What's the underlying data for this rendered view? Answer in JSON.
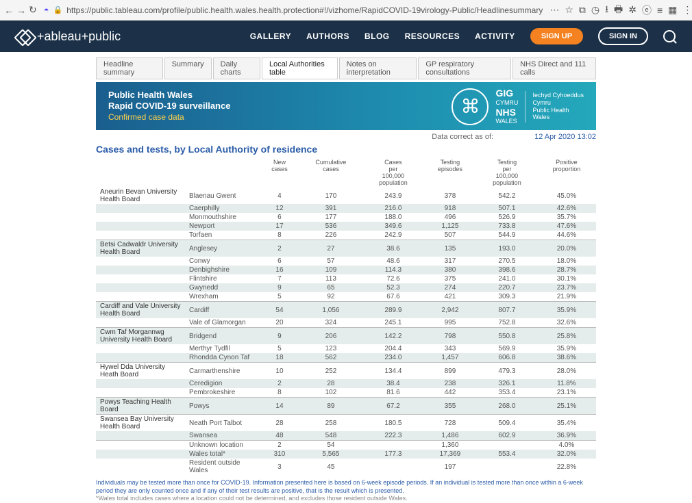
{
  "browser": {
    "url": "https://public.tableau.com/profile/public.health.wales.health.protection#!/vizhome/RapidCOVID-19virology-Public/Headlinesummary"
  },
  "nav": {
    "logo": "+ableau+public",
    "links": [
      "GALLERY",
      "AUTHORS",
      "BLOG",
      "RESOURCES",
      "ACTIVITY"
    ],
    "signup": "SIGN UP",
    "signin": "SIGN IN"
  },
  "tabs": [
    "Headline summary",
    "Summary",
    "Daily charts",
    "Local Authorities table",
    "Notes on interpretation",
    "GP respiratory consultations",
    "NHS Direct and 111 calls"
  ],
  "active_tab": 3,
  "banner": {
    "l1": "Public Health Wales",
    "l2": "Rapid COVID-19 surveillance",
    "l3": "Confirmed case data",
    "gig_l1": "GIG",
    "gig_cymru": "CYMRU",
    "nhs": "NHS",
    "wales": "WALES",
    "r1": "Iechyd Cyhoeddus",
    "r2": "Cymru",
    "r3": "Public Health",
    "r4": "Wales"
  },
  "meta": {
    "label": "Data correct as of:",
    "value": "12 Apr 2020 13:02"
  },
  "title": "Cases and tests, by Local Authority of residence",
  "columns": [
    "New cases",
    "Cumulative cases",
    "Cases per 100,000 population",
    "Testing episodes",
    "Testing per 100,000 population",
    "Positive proportion"
  ],
  "groups": [
    {
      "name": "Aneurin Bevan University Health Board",
      "rows": [
        {
          "la": "Blaenau Gwent",
          "v": [
            "4",
            "170",
            "243.9",
            "378",
            "542.2",
            "45.0%"
          ]
        },
        {
          "la": "Caerphilly",
          "v": [
            "12",
            "391",
            "216.0",
            "918",
            "507.1",
            "42.6%"
          ],
          "sh": 1
        },
        {
          "la": "Monmouthshire",
          "v": [
            "6",
            "177",
            "188.0",
            "496",
            "526.9",
            "35.7%"
          ]
        },
        {
          "la": "Newport",
          "v": [
            "17",
            "536",
            "349.6",
            "1,125",
            "733.8",
            "47.6%"
          ],
          "sh": 1
        },
        {
          "la": "Torfaen",
          "v": [
            "8",
            "226",
            "242.9",
            "507",
            "544.9",
            "44.6%"
          ]
        }
      ]
    },
    {
      "name": "Betsi Cadwaldr University Health Board",
      "rows": [
        {
          "la": "Anglesey",
          "v": [
            "2",
            "27",
            "38.6",
            "135",
            "193.0",
            "20.0%"
          ],
          "sh": 1
        },
        {
          "la": "Conwy",
          "v": [
            "6",
            "57",
            "48.6",
            "317",
            "270.5",
            "18.0%"
          ]
        },
        {
          "la": "Denbighshire",
          "v": [
            "16",
            "109",
            "114.3",
            "380",
            "398.6",
            "28.7%"
          ],
          "sh": 1
        },
        {
          "la": "Flintshire",
          "v": [
            "7",
            "113",
            "72.6",
            "375",
            "241.0",
            "30.1%"
          ]
        },
        {
          "la": "Gwynedd",
          "v": [
            "9",
            "65",
            "52.3",
            "274",
            "220.7",
            "23.7%"
          ],
          "sh": 1
        },
        {
          "la": "Wrexham",
          "v": [
            "5",
            "92",
            "67.6",
            "421",
            "309.3",
            "21.9%"
          ]
        }
      ]
    },
    {
      "name": "Cardiff and Vale University Health Board",
      "rows": [
        {
          "la": "Cardiff",
          "v": [
            "54",
            "1,056",
            "289.9",
            "2,942",
            "807.7",
            "35.9%"
          ],
          "sh": 1
        },
        {
          "la": "Vale of Glamorgan",
          "v": [
            "20",
            "324",
            "245.1",
            "995",
            "752.8",
            "32.6%"
          ]
        }
      ]
    },
    {
      "name": "Cwm Taf Morgannwg University Health Board",
      "rows": [
        {
          "la": "Bridgend",
          "v": [
            "9",
            "206",
            "142.2",
            "798",
            "550.8",
            "25.8%"
          ],
          "sh": 1
        },
        {
          "la": "Merthyr Tydfil",
          "v": [
            "5",
            "123",
            "204.4",
            "343",
            "569.9",
            "35.9%"
          ]
        },
        {
          "la": "Rhondda Cynon Taf",
          "v": [
            "18",
            "562",
            "234.0",
            "1,457",
            "606.8",
            "38.6%"
          ],
          "sh": 1
        }
      ]
    },
    {
      "name": "Hywel Dda University Heath Board",
      "rows": [
        {
          "la": "Carmarthenshire",
          "v": [
            "10",
            "252",
            "134.4",
            "899",
            "479.3",
            "28.0%"
          ]
        },
        {
          "la": "Ceredigion",
          "v": [
            "2",
            "28",
            "38.4",
            "238",
            "326.1",
            "11.8%"
          ],
          "sh": 1
        },
        {
          "la": "Pembrokeshire",
          "v": [
            "8",
            "102",
            "81.6",
            "442",
            "353.4",
            "23.1%"
          ]
        }
      ]
    },
    {
      "name": "Powys Teaching Health Board",
      "rows": [
        {
          "la": "Powys",
          "v": [
            "14",
            "89",
            "67.2",
            "355",
            "268.0",
            "25.1%"
          ],
          "sh": 1
        }
      ]
    },
    {
      "name": "Swansea Bay University Health Board",
      "rows": [
        {
          "la": "Neath Port Talbot",
          "v": [
            "28",
            "258",
            "180.5",
            "728",
            "509.4",
            "35.4%"
          ]
        },
        {
          "la": "Swansea",
          "v": [
            "48",
            "548",
            "222.3",
            "1,486",
            "602.9",
            "36.9%"
          ],
          "sh": 1
        }
      ]
    },
    {
      "name": "",
      "rows": [
        {
          "la": "Unknown location",
          "v": [
            "2",
            "54",
            "",
            "1,360",
            "",
            "4.0%"
          ]
        },
        {
          "la": "Wales total*",
          "v": [
            "310",
            "5,565",
            "177.3",
            "17,369",
            "553.4",
            "32.0%"
          ],
          "sh": 1
        },
        {
          "la": "Resident outside Wales",
          "v": [
            "3",
            "45",
            "",
            "197",
            "",
            "22.8%"
          ]
        }
      ]
    }
  ],
  "footnote": {
    "l1": "Individuals may be tested more than once for COVID-19. Information presented here is based on 6-week episode periods. If an individual is tested more than once within a 6-week period they are only counted once and if any of their test results are positive, that is the result which is presented.",
    "l2": "*Wales total includes cases where a location could not be determined, and excludes those resident outside Wales."
  }
}
